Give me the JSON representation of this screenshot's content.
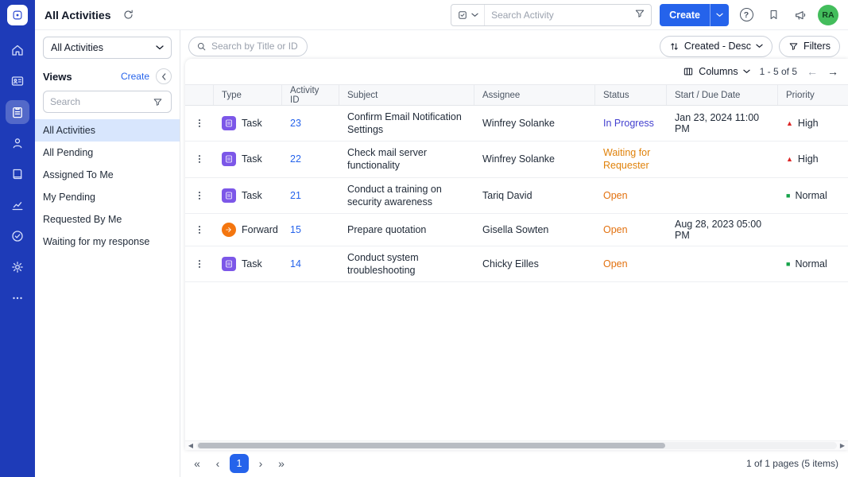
{
  "topbar": {
    "title": "All Activities",
    "search": {
      "placeholder": "Search Activity"
    },
    "create_label": "Create",
    "avatar_initials": "RA"
  },
  "views_panel": {
    "selector_value": "All Activities",
    "section_label": "Views",
    "create_link": "Create",
    "search_placeholder": "Search",
    "items": [
      {
        "label": "All Activities",
        "active": true
      },
      {
        "label": "All Pending",
        "active": false
      },
      {
        "label": "Assigned To Me",
        "active": false
      },
      {
        "label": "My Pending",
        "active": false
      },
      {
        "label": "Requested By Me",
        "active": false
      },
      {
        "label": "Waiting for my response",
        "active": false
      }
    ]
  },
  "list_toolbar": {
    "search_placeholder": "Search by Title or ID",
    "sort_label": "Created - Desc",
    "filters_label": "Filters"
  },
  "table": {
    "columns_label": "Columns",
    "range_label": "1 - 5 of 5",
    "headers": [
      "Type",
      "Activity ID",
      "Subject",
      "Assignee",
      "Status",
      "Start / Due Date",
      "Priority"
    ],
    "rows": [
      {
        "type": "Task",
        "id": "23",
        "subject": "Confirm Email Notification Settings",
        "assignee": "Winfrey Solanke",
        "status": "In Progress",
        "date": "Jan 23, 2024 11:00 PM",
        "priority": "High"
      },
      {
        "type": "Task",
        "id": "22",
        "subject": "Check mail server functionality",
        "assignee": "Winfrey Solanke",
        "status": "Waiting for Requester",
        "date": "",
        "priority": "High"
      },
      {
        "type": "Task",
        "id": "21",
        "subject": "Conduct a training on security awareness",
        "assignee": "Tariq David",
        "status": "Open",
        "date": "",
        "priority": "Normal"
      },
      {
        "type": "Forward",
        "id": "15",
        "subject": "Prepare quotation",
        "assignee": "Gisella Sowten",
        "status": "Open",
        "date": "Aug 28, 2023 05:00 PM",
        "priority": ""
      },
      {
        "type": "Task",
        "id": "14",
        "subject": "Conduct system troubleshooting",
        "assignee": "Chicky Eilles",
        "status": "Open",
        "date": "",
        "priority": "Normal"
      }
    ]
  },
  "pagination": {
    "current_page": "1",
    "summary": "1 of 1 pages (5 items)"
  },
  "icons": {
    "rail": [
      "home-icon",
      "contacts-icon",
      "activities-icon",
      "customers-icon",
      "knowledge-base-icon",
      "analytics-icon",
      "approvals-icon",
      "settings-icon",
      "more-icon"
    ],
    "active_rail_item": "activities-icon"
  },
  "colors": {
    "rail_bg": "#1e3bb8",
    "accent_blue": "#2563eb",
    "active_view_bg": "#d8e6fd",
    "status_in_progress": "#4340cf",
    "status_waiting_for_requester": "#e0820a",
    "status_open": "#e2710f",
    "priority_high": "#dc2626",
    "priority_normal": "#16a34a",
    "task_type_bg": "#7c57e8",
    "forward_type_bg": "#f4760f",
    "avatar_bg": "#43bd5c"
  }
}
